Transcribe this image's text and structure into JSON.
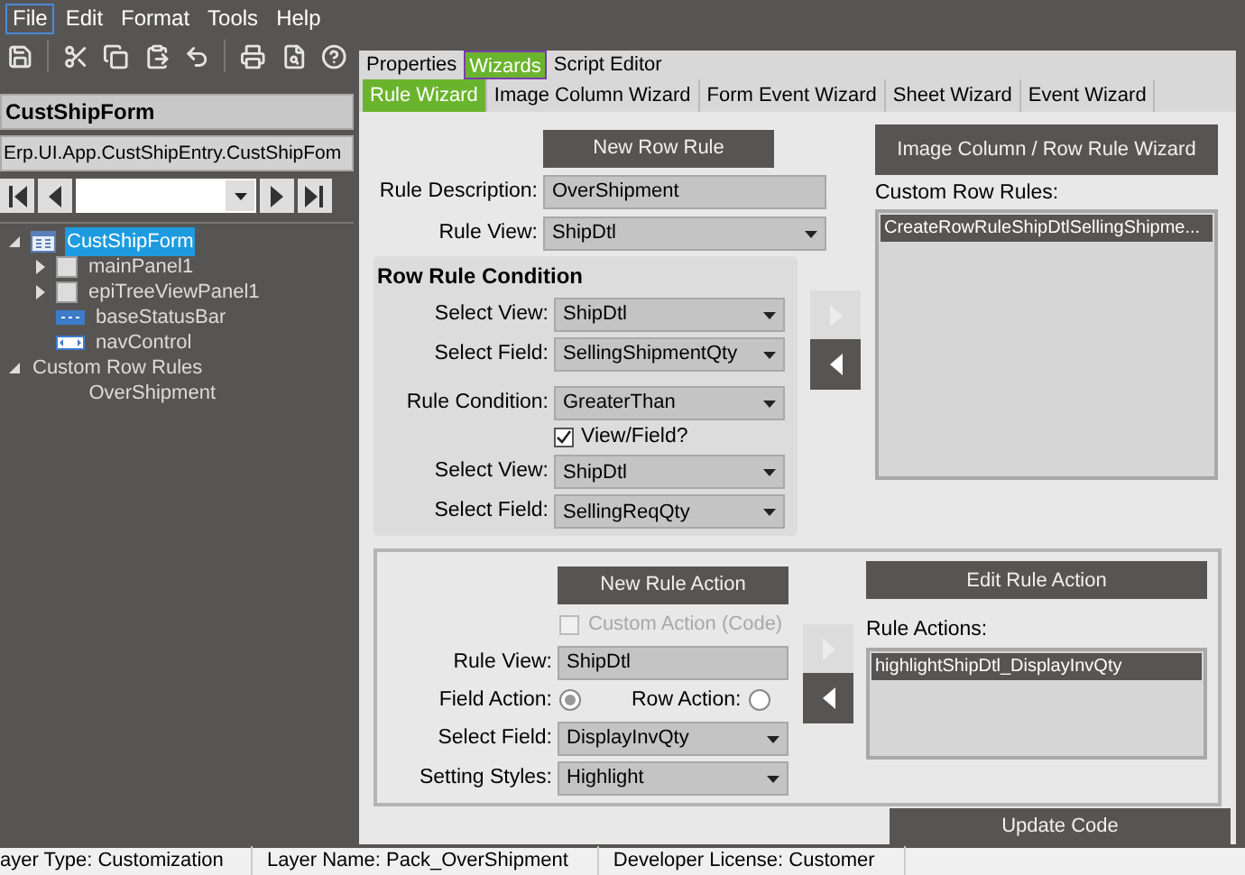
{
  "menu": [
    {
      "label": "File",
      "selected": true
    },
    {
      "label": "Edit",
      "selected": false
    },
    {
      "label": "Format",
      "selected": false
    },
    {
      "label": "Tools",
      "selected": false
    },
    {
      "label": "Help",
      "selected": false
    }
  ],
  "left": {
    "title": "CustShipForm",
    "assembly": "Erp.UI.App.CustShipEntry.CustShipFom",
    "tree": [
      {
        "label": "CustShipForm",
        "kind": "form",
        "expanded": true,
        "selected": true,
        "children": [
          {
            "label": "mainPanel1",
            "kind": "panel",
            "expanded": false,
            "selected": false
          },
          {
            "label": "epiTreeViewPanel1",
            "kind": "panel",
            "expanded": false,
            "selected": false
          },
          {
            "label": "baseStatusBar",
            "kind": "statusbar",
            "selected": false
          },
          {
            "label": "navControl",
            "kind": "nav",
            "selected": false
          }
        ]
      },
      {
        "label": "Custom Row Rules",
        "kind": "group",
        "expanded": true,
        "selected": false,
        "children": [
          {
            "label": "OverShipment",
            "kind": "rule",
            "selected": false
          }
        ]
      }
    ]
  },
  "tabs": [
    {
      "label": "Properties",
      "selected": false
    },
    {
      "label": "Wizards",
      "selected": true
    },
    {
      "label": "Script Editor",
      "selected": false
    }
  ],
  "subtabs": [
    {
      "label": "Rule Wizard",
      "selected": true
    },
    {
      "label": "Image Column Wizard",
      "selected": false
    },
    {
      "label": "Form Event Wizard",
      "selected": false
    },
    {
      "label": "Sheet Wizard",
      "selected": false
    },
    {
      "label": "Event Wizard",
      "selected": false
    }
  ],
  "rule": {
    "new_button": "New Row Rule",
    "description": {
      "label": "Rule Description:",
      "value": "OverShipment"
    },
    "rule_view": {
      "label": "Rule View:",
      "value": "ShipDtl"
    },
    "condition": {
      "title": "Row Rule Condition",
      "fields": [
        {
          "kind": "select",
          "label": "Select View:",
          "value": "ShipDtl"
        },
        {
          "kind": "select",
          "label": "Select Field:",
          "value": "SellingShipmentQty"
        },
        {
          "kind": "select",
          "label": "Rule Condition:",
          "value": "GreaterThan"
        },
        {
          "kind": "check",
          "label": "View/Field?",
          "checked": true
        },
        {
          "kind": "select",
          "label": "Select View:",
          "value": "ShipDtl"
        },
        {
          "kind": "select",
          "label": "Select Field:",
          "value": "SellingReqQty"
        }
      ]
    },
    "add_arrow": {
      "disabled": true
    },
    "remove_arrow": {
      "disabled": false
    },
    "wizard_button": "Image Column / Row Rule Wizard",
    "list_label": "Custom Row Rules:",
    "list": [
      {
        "label": "CreateRowRuleShipDtlSellingShipme...",
        "selected": true
      }
    ]
  },
  "action": {
    "new_button": "New Rule Action",
    "custom_action": {
      "label": "Custom Action (Code)",
      "checked": false,
      "disabled": true
    },
    "rule_view": {
      "label": "Rule View:",
      "value": "ShipDtl"
    },
    "field_action": {
      "label": "Field Action:",
      "selected": true
    },
    "row_action": {
      "label": "Row Action:",
      "selected": false
    },
    "select_field": {
      "label": "Select Field:",
      "value": "DisplayInvQty"
    },
    "setting_styles": {
      "label": "Setting Styles:",
      "value": "Highlight"
    },
    "add_arrow": {
      "disabled": true
    },
    "remove_arrow": {
      "disabled": false
    },
    "edit_button": "Edit Rule Action",
    "list_label": "Rule Actions:",
    "list": [
      {
        "label": "highlightShipDtl_DisplayInvQty",
        "selected": true
      }
    ],
    "update_button": "Update Code"
  },
  "status_bar": [
    "ayer Type:  Customization",
    "Layer Name:  Pack_OverShipment",
    "Developer License:  Customer"
  ]
}
